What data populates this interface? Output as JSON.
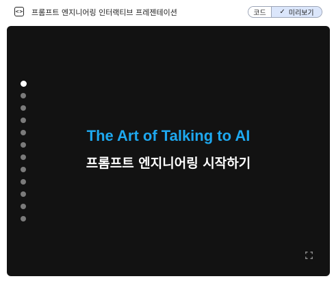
{
  "header": {
    "code_icon_symbol": "<>",
    "title": "프롬프트 엔지니어링 인터랙티브 프레젠테이션",
    "toggle": {
      "code_label": "코드",
      "preview_label": "미리보기",
      "selected": "preview"
    }
  },
  "slide": {
    "title": "The Art of Talking to AI",
    "subtitle": "프롬프트 엔지니어링 시작하기",
    "title_color": "#1ea8ef",
    "background_color": "#121212"
  },
  "navigation": {
    "total_slides": 12,
    "current_slide": 1
  },
  "icons": {
    "code": "code-brackets-icon",
    "check": "check-icon",
    "fullscreen": "fullscreen-icon"
  }
}
